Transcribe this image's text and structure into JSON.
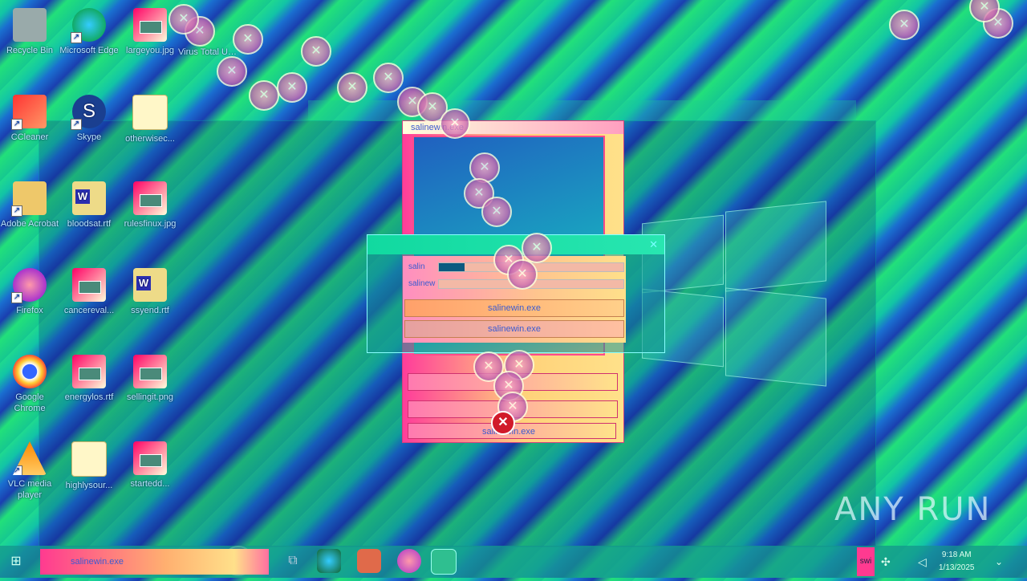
{
  "desktop_icons": [
    {
      "label": "Recycle Bin"
    },
    {
      "label": "Microsoft Edge"
    },
    {
      "label": "largeyou.jpg"
    },
    {
      "label": "Virus Total Upload"
    },
    {
      "label": "CCleaner"
    },
    {
      "label": "Skype"
    },
    {
      "label": "otherwisec..."
    },
    {
      "label": "Adobe Acrobat"
    },
    {
      "label": "bloodsat.rtf"
    },
    {
      "label": "rulesfinux.jpg"
    },
    {
      "label": "Firefox"
    },
    {
      "label": "cancereval..."
    },
    {
      "label": "ssyend.rtf"
    },
    {
      "label": "Google Chrome"
    },
    {
      "label": "energylos.rtf"
    },
    {
      "label": "sellingit.png"
    },
    {
      "label": "VLC media player"
    },
    {
      "label": "highlysour..."
    },
    {
      "label": "startedd..."
    }
  ],
  "back_dialog": {
    "title": "salinewin.exe",
    "row_text": "salinewin.exe"
  },
  "front_dialog": {
    "label1": "salin",
    "label2": "salinew",
    "progress1": 0.14,
    "progress2": 0.0,
    "button1": "salinewin.exe",
    "button2": "salinewin.exe"
  },
  "taskbar": {
    "active_app": "salinewin.exe",
    "tray_app": "swi",
    "time": "9:18 AM",
    "date": "1/13/2025"
  },
  "watermark": "ANY RUN"
}
